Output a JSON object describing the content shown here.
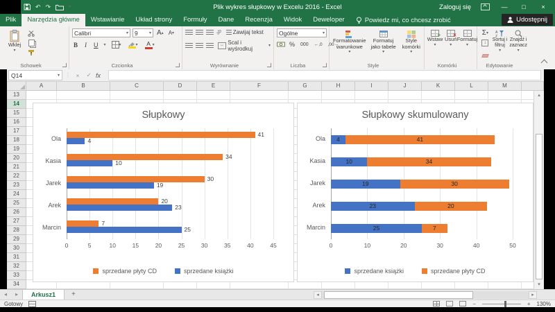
{
  "window": {
    "title": "Plik wykres słupkowy w Excelu 2016  -  Excel",
    "sign_in": "Zaloguj się"
  },
  "icon_glyphs": {
    "dropdown": "▾",
    "up": "▴",
    "down": "▾",
    "left": "◂",
    "right": "▸",
    "close": "×",
    "minimize": "—",
    "maximize": "□",
    "undo": "↶",
    "redo": "↷",
    "cancel": "×",
    "check": "✓",
    "fx": "fx",
    "sum": "Σ",
    "percent": "%",
    "thousands": "000",
    "inc_decimal": "←,0",
    "dec_decimal": ",00→",
    "merge_arrows": "↔",
    "add_sheet": "+",
    "bold": "B",
    "italic": "I",
    "underline": "U",
    "grow_font": "A",
    "shrink_font": "A",
    "font_color": "A",
    "fill_color": "A"
  },
  "ribbon": {
    "tabs": [
      {
        "label": "Plik",
        "active": false
      },
      {
        "label": "Narzędzia główne",
        "active": true
      },
      {
        "label": "Wstawianie",
        "active": false
      },
      {
        "label": "Układ strony",
        "active": false
      },
      {
        "label": "Formuły",
        "active": false
      },
      {
        "label": "Dane",
        "active": false
      },
      {
        "label": "Recenzja",
        "active": false
      },
      {
        "label": "Widok",
        "active": false
      },
      {
        "label": "Deweloper",
        "active": false
      }
    ],
    "tell_me": "Powiedz mi, co chcesz zrobić",
    "share": "Udostępnij",
    "groups": {
      "clipboard": {
        "label": "Schowek",
        "paste": "Wklej"
      },
      "font": {
        "label": "Czcionka",
        "font_name": "Calibri",
        "font_size": "9"
      },
      "alignment": {
        "label": "Wyrównanie",
        "wrap": "Zawijaj tekst",
        "merge": "Scal i wyśrodkuj"
      },
      "number": {
        "label": "Liczba",
        "format": "Ogólne"
      },
      "styles": {
        "label": "Style",
        "conditional": "Formatowanie warunkowe",
        "format_table": "Formatuj jako tabele",
        "cell_styles": "Style komórki"
      },
      "cells": {
        "label": "Komórki",
        "insert": "Wstaw",
        "delete": "Usuń",
        "format": "Formatuj"
      },
      "editing": {
        "label": "Edytowanie",
        "sort": "Sortuj i filtruj",
        "find": "Znajdź i zaznacz"
      }
    }
  },
  "formula_bar": {
    "name_box": "Q14"
  },
  "grid": {
    "columns": [
      "A",
      "B",
      "C",
      "D",
      "E",
      "F",
      "G",
      "H",
      "I",
      "J",
      "K",
      "L",
      "M"
    ],
    "row_first": 13,
    "row_last": 34,
    "selected_row": 14
  },
  "chart_data": [
    {
      "type": "bar",
      "orientation": "horizontal",
      "stacked": false,
      "title": "Słupkowy",
      "categories": [
        "Ola",
        "Kasia",
        "Jarek",
        "Arek",
        "Marcin"
      ],
      "series": [
        {
          "name": "sprzedane płyty CD",
          "color": "#ED7D31",
          "values": [
            41,
            34,
            30,
            20,
            7
          ]
        },
        {
          "name": "sprzedane książki",
          "color": "#4472C4",
          "values": [
            4,
            10,
            19,
            23,
            25
          ]
        }
      ],
      "xlim": [
        0,
        45
      ],
      "xtick_step": 5,
      "value_labels": "outside-end",
      "legend_position": "bottom",
      "gridlines": true
    },
    {
      "type": "bar",
      "orientation": "horizontal",
      "stacked": true,
      "title": "Słupkowy skumulowany",
      "categories": [
        "Ola",
        "Kasia",
        "Jarek",
        "Arek",
        "Marcin"
      ],
      "series": [
        {
          "name": "sprzedane książki",
          "color": "#4472C4",
          "values": [
            4,
            10,
            19,
            23,
            25
          ]
        },
        {
          "name": "sprzedane płyty CD",
          "color": "#ED7D31",
          "values": [
            41,
            34,
            30,
            20,
            7
          ]
        }
      ],
      "xlim": [
        0,
        50
      ],
      "xtick_step": 10,
      "value_labels": "inside-center",
      "legend_position": "bottom",
      "gridlines": true
    }
  ],
  "sheet_bar": {
    "active_tab": "Arkusz1"
  },
  "status_bar": {
    "mode": "Gotowy",
    "zoom_level": "130%"
  }
}
